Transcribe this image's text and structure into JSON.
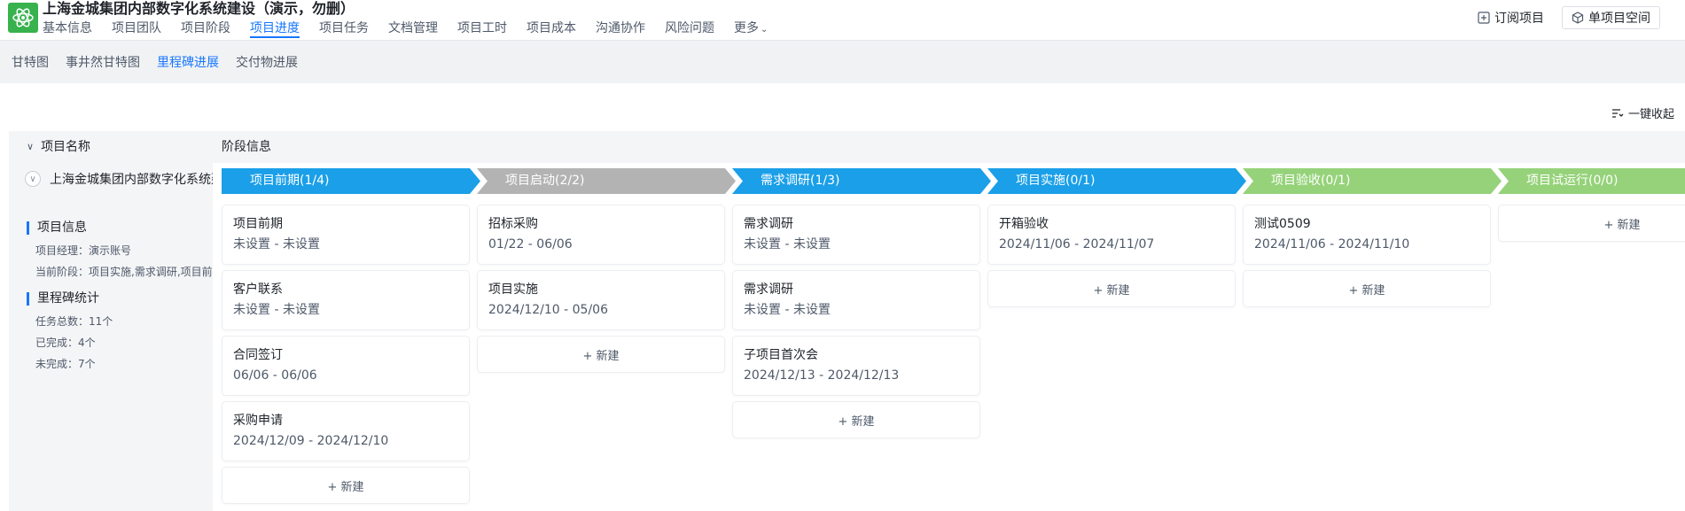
{
  "header": {
    "project_title": "上海金城集团内部数字化系统建设（演示，勿删）",
    "nav": [
      {
        "label": "基本信息"
      },
      {
        "label": "项目团队"
      },
      {
        "label": "项目阶段"
      },
      {
        "label": "项目进度"
      },
      {
        "label": "项目任务"
      },
      {
        "label": "文档管理"
      },
      {
        "label": "项目工时"
      },
      {
        "label": "项目成本"
      },
      {
        "label": "沟通协作"
      },
      {
        "label": "风险问题"
      },
      {
        "label": "更多"
      }
    ],
    "active_nav": "项目进度",
    "subscribe_label": "订阅项目",
    "space_label": "单项目空间"
  },
  "subtabs": [
    {
      "label": "甘特图"
    },
    {
      "label": "事井然甘特图"
    },
    {
      "label": "里程碑进展"
    },
    {
      "label": "交付物进展"
    }
  ],
  "active_subtab": "里程碑进展",
  "toolbar": {
    "collapse_all_label": "一键收起"
  },
  "table": {
    "col_name": "项目名称",
    "col_stage": "阶段信息"
  },
  "project": {
    "name": "上海金城集团内部数字化系统建设（演示，勿删）",
    "info_title": "项目信息",
    "manager": "项目经理：演示账号",
    "current_stage": "当前阶段：项目实施,需求调研,项目前期",
    "stats_title": "里程碑统计",
    "total": "任务总数：11个",
    "done": "已完成：4个",
    "undone": "未完成：7个"
  },
  "new_label": "+ 新建",
  "stages": [
    {
      "label": "项目前期(1/4)",
      "color": "#1a9fe8",
      "cards": [
        {
          "title": "项目前期",
          "date": "未设置 - 未设置"
        },
        {
          "title": "客户联系",
          "date": "未设置 - 未设置"
        },
        {
          "title": "合同签订",
          "date": "06/06 - 06/06"
        },
        {
          "title": "采购申请",
          "date": "2024/12/09 - 2024/12/10"
        }
      ]
    },
    {
      "label": "项目启动(2/2)",
      "color": "#b3b3b3",
      "cards": [
        {
          "title": "招标采购",
          "date": "01/22 - 06/06"
        },
        {
          "title": "项目实施",
          "date": "2024/12/10 - 05/06"
        }
      ]
    },
    {
      "label": "需求调研(1/3)",
      "color": "#1a9fe8",
      "cards": [
        {
          "title": "需求调研",
          "date": "未设置 - 未设置"
        },
        {
          "title": "需求调研",
          "date": "未设置 - 未设置"
        },
        {
          "title": "子项目首次会",
          "date": "2024/12/13 - 2024/12/13"
        }
      ]
    },
    {
      "label": "项目实施(0/1)",
      "color": "#1a9fe8",
      "cards": [
        {
          "title": "开箱验收",
          "date": "2024/11/06 - 2024/11/07"
        }
      ]
    },
    {
      "label": "项目验收(0/1)",
      "color": "#95d279",
      "cards": [
        {
          "title": "测试0509",
          "date": "2024/11/06 - 2024/11/10"
        }
      ]
    },
    {
      "label": "项目试运行(0/0)",
      "color": "#95d279",
      "cards": []
    }
  ]
}
